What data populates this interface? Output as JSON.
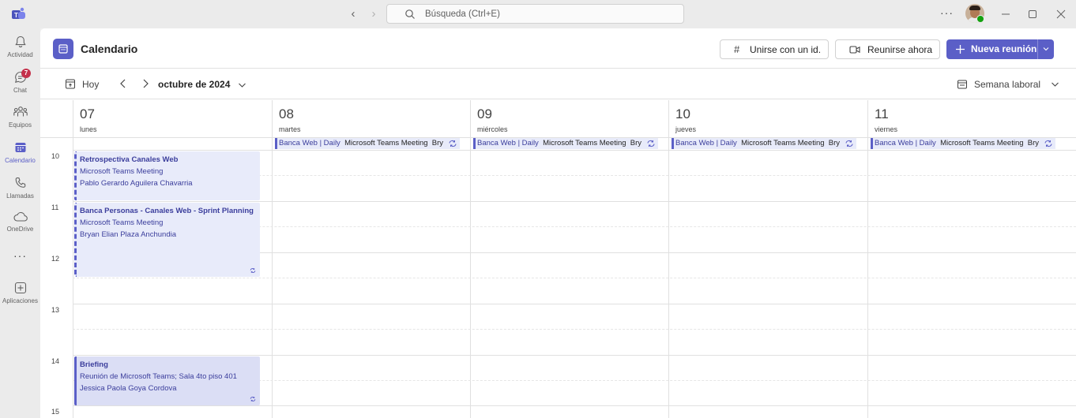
{
  "search": {
    "placeholder": "Búsqueda (Ctrl+E)"
  },
  "titlebar": {
    "more_label": "···"
  },
  "rail": [
    {
      "label": "Actividad",
      "icon": "bell-icon"
    },
    {
      "label": "Chat",
      "icon": "chat-icon",
      "badge": "7"
    },
    {
      "label": "Equipos",
      "icon": "teams-icon"
    },
    {
      "label": "Calendario",
      "icon": "calendar-icon",
      "active": true
    },
    {
      "label": "Llamadas",
      "icon": "phone-icon"
    },
    {
      "label": "OneDrive",
      "icon": "cloud-icon"
    },
    {
      "label": "···",
      "icon": "more-icon"
    },
    {
      "label": "Aplicaciones",
      "icon": "add-apps-icon"
    }
  ],
  "header": {
    "title": "Calendario",
    "join_id": "Unirse con un id.",
    "meet_now": "Reunirse ahora",
    "new_meeting": "Nueva reunión"
  },
  "toolbar": {
    "today": "Hoy",
    "month": "octubre de 2024",
    "view": "Semana laboral"
  },
  "days": [
    {
      "num": "07",
      "name": "lunes"
    },
    {
      "num": "08",
      "name": "martes"
    },
    {
      "num": "09",
      "name": "miércoles"
    },
    {
      "num": "10",
      "name": "jueves"
    },
    {
      "num": "11",
      "name": "viernes"
    }
  ],
  "hours": [
    "10",
    "11",
    "12",
    "13",
    "14",
    "15"
  ],
  "recurring_banner": {
    "title": "Banca Web | Daily",
    "location": "Microsoft Teams Meeting",
    "organizer": "Bry"
  },
  "events": [
    {
      "title": "Retrospectiva Canales Web",
      "location": "Microsoft Teams Meeting",
      "organizer": "Pablo Gerardo Aguilera Chavarria"
    },
    {
      "title": "Banca Personas - Canales Web - Sprint Planning",
      "location": "Microsoft Teams Meeting",
      "organizer": "Bryan Elian Plaza Anchundia"
    },
    {
      "title": "Briefing",
      "location": "Reunión de Microsoft Teams; Sala 4to piso 401",
      "organizer": "Jessica Paola Goya Cordova"
    }
  ],
  "colors": {
    "accent": "#5b5fc7",
    "event_bg": "#e8ebfa",
    "badge": "#c4314b",
    "presence": "#13a10e"
  }
}
